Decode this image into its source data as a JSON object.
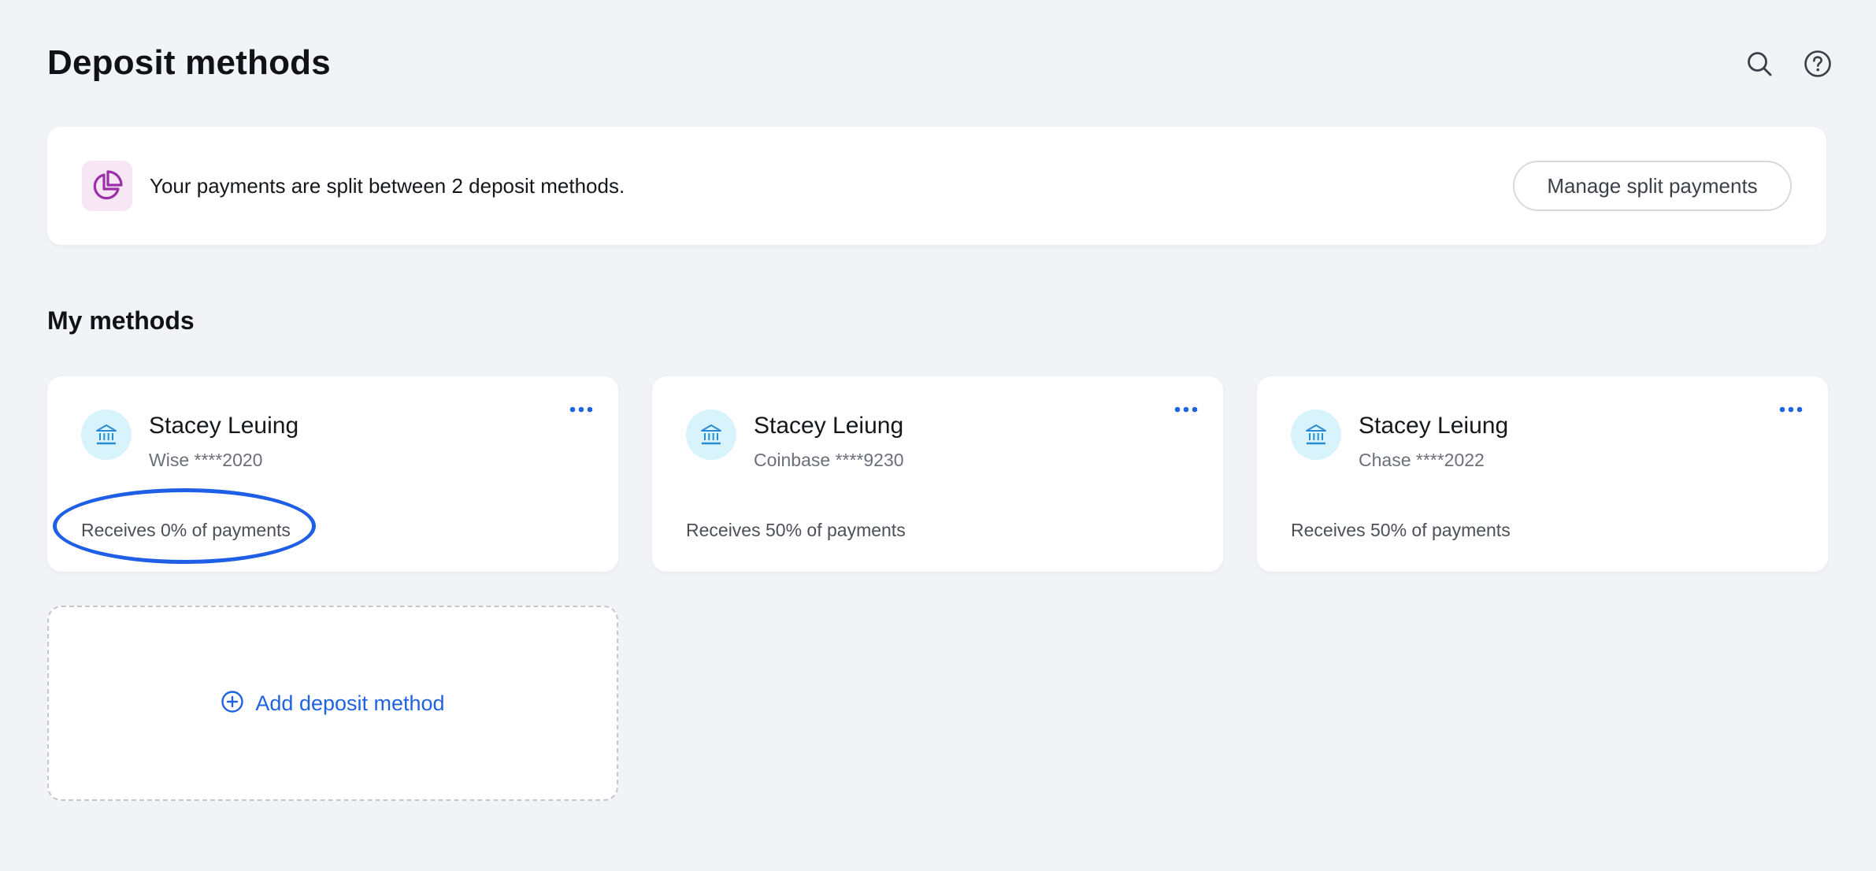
{
  "page": {
    "title": "Deposit methods"
  },
  "header": {
    "icons": [
      "search-icon",
      "help-circle-icon"
    ]
  },
  "banner": {
    "icon": "pie-chart-icon",
    "text": "Your payments are split between 2 deposit methods.",
    "button_label": "Manage split payments"
  },
  "section": {
    "title": "My methods"
  },
  "methods": [
    {
      "name": "Stacey Leuing",
      "account": "Wise ****2020",
      "share": "Receives 0% of payments",
      "icon": "bank-icon",
      "highlighted": true
    },
    {
      "name": "Stacey Leiung",
      "account": "Coinbase ****9230",
      "share": "Receives 50% of payments",
      "icon": "bank-icon",
      "highlighted": false
    },
    {
      "name": "Stacey Leiung",
      "account": "Chase ****2022",
      "share": "Receives 50% of payments",
      "icon": "bank-icon",
      "highlighted": false
    }
  ],
  "add_method": {
    "label": "Add deposit method",
    "icon": "plus-circle-icon"
  },
  "colors": {
    "background": "#f2f3f7",
    "card": "#ffffff",
    "accent_blue": "#1f63e0",
    "highlight_ring": "#1e5fe6",
    "banner_icon_bg": "#f7e6f4",
    "banner_icon_fg": "#9b2fa8",
    "bank_icon_bg": "#d9f3fc",
    "bank_icon_fg": "#2a8bd6"
  }
}
